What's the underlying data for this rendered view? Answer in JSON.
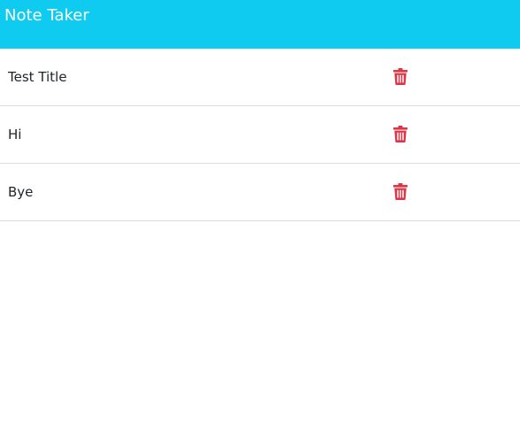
{
  "header": {
    "title": "Note Taker"
  },
  "notes": [
    {
      "title": "Test Title",
      "action_icon": "trash-icon"
    },
    {
      "title": "Hi",
      "action_icon": "trash-icon"
    },
    {
      "title": "Bye",
      "action_icon": "trash-icon"
    }
  ],
  "colors": {
    "navbar": "#0fcbf0",
    "navbar_text": "#ffffff",
    "delete_icon": "#dc3545",
    "divider": "#dcdcdc",
    "text": "#212529"
  }
}
